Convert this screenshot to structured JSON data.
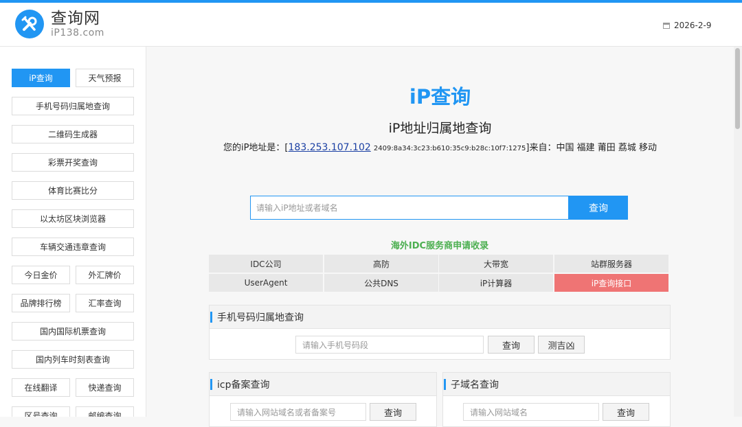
{
  "header": {
    "logo_name": "查询网",
    "logo_domain": "iP138.com",
    "date": "2026-2-9"
  },
  "sidebar": {
    "items": [
      {
        "label": "iP查询",
        "active": true
      },
      {
        "label": "天气预报"
      },
      {
        "label": "手机号码归属地查询"
      },
      {
        "label": "二维码生成器"
      },
      {
        "label": "彩票开奖查询"
      },
      {
        "label": "体育比赛比分"
      },
      {
        "label": "以太坊区块浏览器"
      },
      {
        "label": "车辆交通违章查询"
      },
      {
        "label": "今日金价"
      },
      {
        "label": "外汇牌价"
      },
      {
        "label": "品牌排行榜"
      },
      {
        "label": "汇率查询"
      },
      {
        "label": "国内国际机票查询"
      },
      {
        "label": "国内列车时刻表查询"
      },
      {
        "label": "在线翻译"
      },
      {
        "label": "快递查询"
      },
      {
        "label": "区号查询"
      },
      {
        "label": "邮编查询"
      }
    ]
  },
  "main": {
    "ip_title": "iP查询",
    "sub_title": "iP地址归属地查询",
    "your_ip_prefix": "您的iP地址是：[",
    "your_ip": "183.253.107.102",
    "your_ipv6": "2409:8a34:3c23:b610:35c9:b28c:10f7:1275",
    "your_ip_suffix": "]来自：中国 福建 莆田 荔城 移动",
    "search_placeholder": "请输入iP地址或者域名",
    "search_button": "查询",
    "idc_title": "海外IDC服务商申请收录",
    "grid": [
      {
        "label": "IDC公司"
      },
      {
        "label": "高防"
      },
      {
        "label": "大带宽"
      },
      {
        "label": "站群服务器"
      },
      {
        "label": "UserAgent"
      },
      {
        "label": "公共DNS"
      },
      {
        "label": "iP计算器"
      },
      {
        "label": "iP查询接口",
        "highlight": true
      }
    ],
    "phone_panel": {
      "title": "手机号码归属地查询",
      "placeholder": "请输入手机号码段",
      "button": "查询",
      "button2": "测吉凶"
    },
    "icp_panel": {
      "title": "icp备案查询",
      "placeholder": "请输入网站域名或者备案号",
      "button": "查询"
    },
    "subdomain_panel": {
      "title": "子域名查询",
      "placeholder": "请输入网站域名",
      "button": "查询"
    }
  },
  "colors": {
    "accent": "#2196f3",
    "green_title": "#4caf50",
    "highlight_red": "#ef7474"
  }
}
